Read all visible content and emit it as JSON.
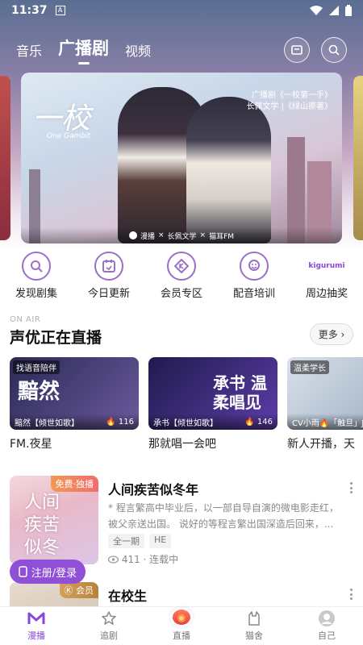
{
  "status_bar": {
    "time": "11:37",
    "a_icon": "A"
  },
  "top_nav": {
    "tabs": [
      {
        "label": "音乐",
        "active": false
      },
      {
        "label": "广播剧",
        "active": true
      },
      {
        "label": "视频",
        "active": false
      }
    ],
    "icons": [
      "mail-icon",
      "search-icon"
    ]
  },
  "banner": {
    "calligraphy": "一校",
    "calligraphy_sub": "One Gambit",
    "caption_line1": "广播剧《一校第一手》",
    "caption_line2": "长佩文学 |《绿山原著》",
    "footer": {
      "brand": "漫播",
      "partner": "长佩文学",
      "studio": "猫耳FM"
    }
  },
  "quick_menu": [
    {
      "label": "发现剧集",
      "icon": "discover-icon"
    },
    {
      "label": "今日更新",
      "icon": "calendar-icon"
    },
    {
      "label": "会员专区",
      "icon": "vip-icon"
    },
    {
      "label": "配音培训",
      "icon": "mic-training-icon"
    },
    {
      "label": "周边抽奖",
      "icon": "kigurumi-icon",
      "icon_text": "kigurumi"
    }
  ],
  "live_section": {
    "eyebrow": "ON AIR",
    "title": "声优正在直播",
    "more_label": "更多 ›",
    "cards": [
      {
        "tag": "找语音陪伴",
        "art_text": "黯然",
        "caption": "黯然【倾世如歌】",
        "viewers": "116",
        "name": "FM.夜星",
        "colors": [
          "#2a2a55",
          "#6c5a9e"
        ]
      },
      {
        "tag": "",
        "art_text": "承书 温柔唱见",
        "caption": "承书【倾世如歌】",
        "viewers": "146",
        "name": "那就唱一会吧",
        "colors": [
          "#1f1b4d",
          "#5d3da8"
        ]
      },
      {
        "tag": "温柔学长",
        "art_text": "",
        "caption": "CV小雨🔥「触旦」J",
        "viewers": "",
        "name": "新人开播，天",
        "colors": [
          "#d9e0ea",
          "#a6b6c8"
        ]
      }
    ]
  },
  "dramas": [
    {
      "title": "人间疾苦似冬年",
      "badge": "免费·独播",
      "cover_text": "人间疾苦似冬年",
      "description": "* 程言繁高中毕业后，以一部自导自演的微电影走红，被父亲送出国。 说好的等程言繁出国深造后回来，...",
      "tags": [
        "全一期",
        "HE"
      ],
      "meta": "411 · 连载中"
    },
    {
      "title": "在校生",
      "badge": "会员",
      "cover_text": "",
      "description": "",
      "tags": [],
      "meta": ""
    }
  ],
  "login_button": {
    "label": "注册/登录"
  },
  "bottom_nav": [
    {
      "label": "漫播",
      "active": true,
      "icon": "manbo-logo-icon"
    },
    {
      "label": "追剧",
      "active": false,
      "icon": "star-icon"
    },
    {
      "label": "直播",
      "active": false,
      "icon": "live-icon"
    },
    {
      "label": "猫舍",
      "active": false,
      "icon": "cat-icon"
    },
    {
      "label": "自己",
      "active": false,
      "icon": "avatar-icon"
    }
  ],
  "colors": {
    "accent": "#8a46d8",
    "login_bg": "#8f4fd6",
    "badge_free": "#f06d6d",
    "badge_vip": "#c8954c"
  }
}
